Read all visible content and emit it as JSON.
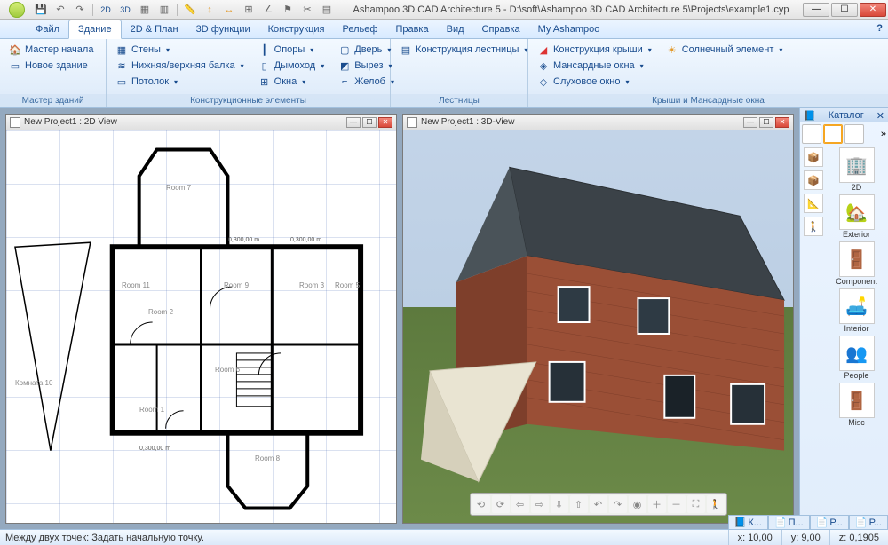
{
  "title": "Ashampoo 3D CAD Architecture 5 - D:\\soft\\Ashampoo 3D CAD Architecture 5\\Projects\\example1.cyp",
  "qat_labels": {
    "2d": "2D",
    "3d": "3D"
  },
  "menu": [
    "Файл",
    "Здание",
    "2D & План",
    "3D функции",
    "Конструкция",
    "Рельеф",
    "Правка",
    "Вид",
    "Справка",
    "My Ashampoo"
  ],
  "menu_active_index": 1,
  "ribbon": {
    "g0": {
      "title": "Мастер зданий",
      "items": [
        {
          "icon": "🏠",
          "label": "Мастер начала"
        },
        {
          "icon": "▭",
          "label": "Новое здание"
        }
      ]
    },
    "g1": {
      "title": "Конструкционные элементы",
      "cols": [
        [
          {
            "icon": "▦",
            "label": "Стены",
            "dd": true
          },
          {
            "icon": "≋",
            "label": "Нижняя/верхняя балка",
            "dd": true
          },
          {
            "icon": "▭",
            "label": "Потолок",
            "dd": true
          }
        ],
        [
          {
            "icon": "┃",
            "label": "Опоры",
            "dd": true
          },
          {
            "icon": "▯",
            "label": "Дымоход",
            "dd": true
          },
          {
            "icon": "⊞",
            "label": "Окна",
            "dd": true
          }
        ],
        [
          {
            "icon": "▢",
            "label": "Дверь",
            "dd": true
          },
          {
            "icon": "◩",
            "label": "Вырез",
            "dd": true
          },
          {
            "icon": "⌐",
            "label": "Желоб",
            "dd": true
          }
        ]
      ]
    },
    "g2": {
      "title": "Лестницы",
      "items": [
        {
          "icon": "▤",
          "label": "Конструкция лестницы",
          "dd": true
        }
      ]
    },
    "g3": {
      "title": "Крыши и Мансардные окна",
      "cols": [
        [
          {
            "icon": "🔴",
            "label": "Конструкция крыши",
            "dd": true
          },
          {
            "icon": "◈",
            "label": "Мансардные окна",
            "dd": true
          },
          {
            "icon": "◇",
            "label": "Слуховое окно",
            "dd": true
          }
        ],
        [
          {
            "icon": "☀",
            "label": "Солнечный элемент",
            "dd": true
          }
        ]
      ]
    }
  },
  "mdi": {
    "left_title": "New Project1 : 2D View",
    "right_title": "New Project1 : 3D-View"
  },
  "rooms": {
    "r1": "Room 1",
    "r2": "Room 2",
    "r3": "Room 3",
    "r5": "Room 5",
    "r6": "Room 6",
    "r7": "Room 7",
    "r8": "Room 8",
    "r9": "Room 9",
    "r11": "Room 11",
    "r10": "Комната 10"
  },
  "dims": {
    "d1": "0,300,00 m",
    "d2": "0,300,00 m",
    "d3": "0,300,00 m"
  },
  "catalog": {
    "title": "Каталог",
    "items": [
      "2D",
      "Exterior",
      "Component",
      "Interior",
      "People",
      "Misc"
    ]
  },
  "status": {
    "hint": "Между двух точек: Задать начальную точку.",
    "x": "x: 10,00",
    "y": "y: 9,00",
    "z": "z: 0,1905",
    "tabs": [
      "К...",
      "П...",
      "Р...",
      "Р..."
    ]
  }
}
